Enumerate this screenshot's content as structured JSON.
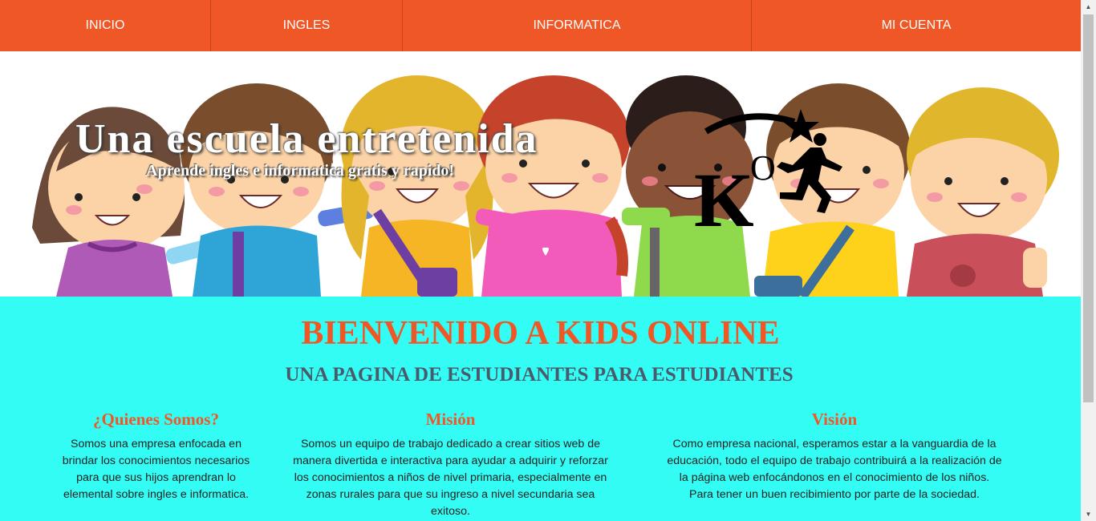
{
  "nav": {
    "items": [
      {
        "label": "INICIO"
      },
      {
        "label": "INGLES"
      },
      {
        "label": "INFORMATICA"
      },
      {
        "label": "MI CUENTA"
      }
    ]
  },
  "hero": {
    "title": "Una escuela entretenida",
    "subtitle": "Aprende ingles e informatica gratis y rapido!",
    "logo_text": "KO"
  },
  "main": {
    "welcome": "BIENVENIDO A KIDS ONLINE",
    "tagline": "UNA PAGINA DE ESTUDIANTES PARA ESTUDIANTES",
    "columns": [
      {
        "heading": "¿Quienes Somos?",
        "text": "Somos una empresa enfocada en brindar los conocimientos necesarios para que sus hijos aprendran lo elemental sobre ingles e informatica."
      },
      {
        "heading": "Misión",
        "text": "Somos un equipo de trabajo dedicado a crear sitios web de manera divertida e interactiva para ayudar a adquirir y reforzar los conocimientos a niños de nivel primaria, especialmente en zonas rurales para que su ingreso a nivel secundaria sea exitoso."
      },
      {
        "heading": "Visión",
        "text": "Como empresa nacional, esperamos estar a la vanguardia de la educación, todo el equipo de trabajo contribuirá a la realización de la página web enfocándonos en el conocimiento de los niños. Para tener un buen recibimiento por parte de la sociedad."
      }
    ]
  },
  "colors": {
    "nav_bg": "#ef5726",
    "main_bg": "#33fcf4",
    "heading": "#ef5726",
    "tagline": "#4b5a6b"
  }
}
